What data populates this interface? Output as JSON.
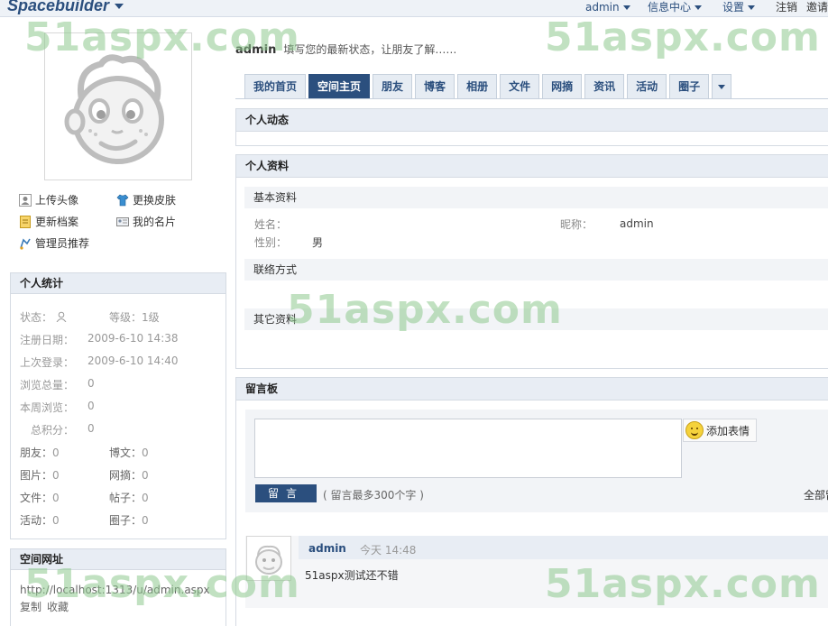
{
  "header": {
    "logo": "Spacebuilder",
    "nav": [
      {
        "label": "admin",
        "dropdown": true
      },
      {
        "label": "信息中心",
        "dropdown": true
      },
      {
        "label": "设置",
        "dropdown": true
      },
      {
        "label": "注销",
        "dropdown": false
      },
      {
        "label": "邀请",
        "dropdown": false
      }
    ]
  },
  "watermark": "51aspx.com",
  "profile": {
    "name": "admin",
    "status_prompt": "填写您的最新状态，让朋友了解……",
    "quick_links": [
      {
        "label": "上传头像",
        "icon": "person-card-icon"
      },
      {
        "label": "更换皮肤",
        "icon": "shirt-icon"
      },
      {
        "label": "更新档案",
        "icon": "document-icon"
      },
      {
        "label": "我的名片",
        "icon": "id-card-icon"
      },
      {
        "label": "管理员推荐",
        "icon": "recommend-icon"
      }
    ]
  },
  "stats": {
    "title": "个人统计",
    "status_label": "状态：",
    "level_label": "等级：",
    "level_value": "1级",
    "register_label": "注册日期：",
    "register_value": "2009-6-10 14:38",
    "last_login_label": "上次登录：",
    "last_login_value": "2009-6-10 14:40",
    "views_total_label": "浏览总量：",
    "views_total_value": "0",
    "views_week_label": "本周浏览：",
    "views_week_value": "0",
    "points_label": "总积分：",
    "points_value": "0",
    "items": [
      {
        "label": "朋友：",
        "value": "0"
      },
      {
        "label": "博文：",
        "value": "0"
      },
      {
        "label": "图片：",
        "value": "0"
      },
      {
        "label": "网摘：",
        "value": "0"
      },
      {
        "label": "文件：",
        "value": "0"
      },
      {
        "label": "帖子：",
        "value": "0"
      },
      {
        "label": "活动：",
        "value": "0"
      },
      {
        "label": "圈子：",
        "value": "0"
      }
    ]
  },
  "space_url": {
    "title": "空间网址",
    "url": "http://localhost:1313/u/admin.aspx",
    "copy": "复制",
    "favorite": "收藏"
  },
  "tabs": [
    "我的首页",
    "空间主页",
    "朋友",
    "博客",
    "相册",
    "文件",
    "网摘",
    "资讯",
    "活动",
    "圈子"
  ],
  "active_tab": "空间主页",
  "sections": {
    "activity": "个人动态",
    "profile": "个人资料",
    "basic": "基本资料",
    "name_label": "姓名：",
    "nickname_label": "昵称：",
    "nickname_value": "admin",
    "gender_label": "性别：",
    "gender_value": "男",
    "contact": "联络方式",
    "other": "其它资料"
  },
  "guestbook": {
    "title": "留言板",
    "emoji_button": "添加表情",
    "post_button": "留言",
    "hint": "( 留言最多300个字 )",
    "all_link": "全部留言",
    "comments": [
      {
        "author": "admin",
        "time": "今天 14:48",
        "text": "51aspx测试还不错"
      }
    ]
  }
}
